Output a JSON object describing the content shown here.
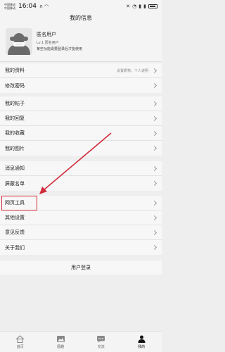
{
  "status_bar": {
    "carrier_1": "中国移动",
    "carrier_2": "中国移动",
    "time": "16:04"
  },
  "page": {
    "title": "我的信息"
  },
  "profile": {
    "name": "匿名用户",
    "level": "Lv.1 匿名用户",
    "hint": "某些功能需要登录后才能使用"
  },
  "menu_groups": [
    [
      {
        "label": "我的资料",
        "hint": "设置昵称、个人说明"
      },
      {
        "label": "修改密码"
      }
    ],
    [
      {
        "label": "我的帖子"
      },
      {
        "label": "我的回复"
      },
      {
        "label": "我的收藏"
      },
      {
        "label": "我的图片"
      }
    ],
    [
      {
        "label": "消息通知"
      },
      {
        "label": "屏蔽名单"
      }
    ],
    [
      {
        "label": "网页工具"
      },
      {
        "label": "其他设置"
      },
      {
        "label": "意见反馈"
      },
      {
        "label": "关于我们"
      }
    ]
  ],
  "login_button": "用户登录",
  "bottom_nav": [
    {
      "label": "首页",
      "icon": "home-icon"
    },
    {
      "label": "图趣",
      "icon": "image-icon"
    },
    {
      "label": "交流",
      "icon": "chat-icon"
    },
    {
      "label": "我的",
      "icon": "person-icon",
      "active": true
    }
  ],
  "colors": {
    "annotation_red": "#d02c3c",
    "active_nav": "#111111"
  }
}
